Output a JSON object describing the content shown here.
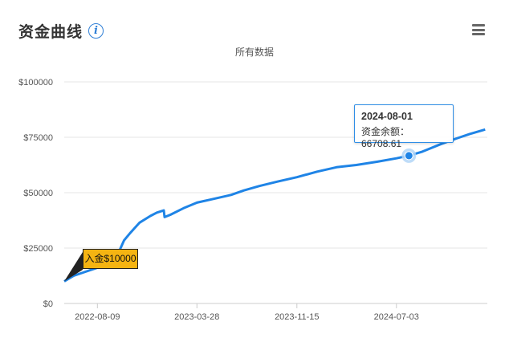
{
  "header": {
    "title": "资金曲线",
    "info_icon": "info-icon",
    "menu_icon": "hamburger-menu-icon"
  },
  "chart_data": {
    "type": "line",
    "title": "资金曲线",
    "subtitle": "所有数据",
    "xlabel": "",
    "ylabel": "",
    "ylim": [
      0,
      100000
    ],
    "y_ticks": [
      0,
      25000,
      50000,
      75000,
      100000
    ],
    "y_tick_labels": [
      "$0",
      "$25000",
      "$50000",
      "$75000",
      "$100000"
    ],
    "x_ticks": [
      "2022-08-09",
      "2023-03-28",
      "2023-11-15",
      "2024-07-03"
    ],
    "xlim": [
      "2022-05-24",
      "2025-01-30"
    ],
    "grid": true,
    "legend": "none",
    "line_color": "#1f84e6",
    "series": [
      {
        "values": [
          [
            "2022-05-24",
            10000
          ],
          [
            "2022-06-15",
            12500
          ],
          [
            "2022-07-15",
            14500
          ],
          [
            "2022-08-15",
            16500
          ],
          [
            "2022-09-05",
            18500
          ],
          [
            "2022-09-25",
            22000
          ],
          [
            "2022-10-10",
            28500
          ],
          [
            "2022-10-25",
            32000
          ],
          [
            "2022-11-15",
            36500
          ],
          [
            "2022-12-10",
            39500
          ],
          [
            "2022-12-25",
            41000
          ],
          [
            "2023-01-10",
            42000
          ],
          [
            "2023-01-12",
            39000
          ],
          [
            "2023-01-25",
            40000
          ],
          [
            "2023-02-25",
            43000
          ],
          [
            "2023-03-28",
            45500
          ],
          [
            "2023-05-01",
            47000
          ],
          [
            "2023-06-15",
            49000
          ],
          [
            "2023-07-15",
            51000
          ],
          [
            "2023-08-20",
            53000
          ],
          [
            "2023-10-01",
            55000
          ],
          [
            "2023-11-15",
            57000
          ],
          [
            "2024-01-01",
            59500
          ],
          [
            "2024-02-15",
            61500
          ],
          [
            "2024-04-01",
            62500
          ],
          [
            "2024-05-20",
            64000
          ],
          [
            "2024-07-03",
            65500
          ],
          [
            "2024-08-01",
            66708.61
          ],
          [
            "2024-09-01",
            68500
          ],
          [
            "2024-10-15",
            72000
          ],
          [
            "2024-11-20",
            74500
          ],
          [
            "2024-12-20",
            76500
          ],
          [
            "2025-01-25",
            78500
          ]
        ]
      }
    ],
    "tooltip": {
      "date": "2024-08-01",
      "label": "资金余额：",
      "value": "66708.61"
    },
    "flag": {
      "date": "2022-05-24",
      "text": "入金$10000",
      "color": "#f5b412"
    }
  }
}
